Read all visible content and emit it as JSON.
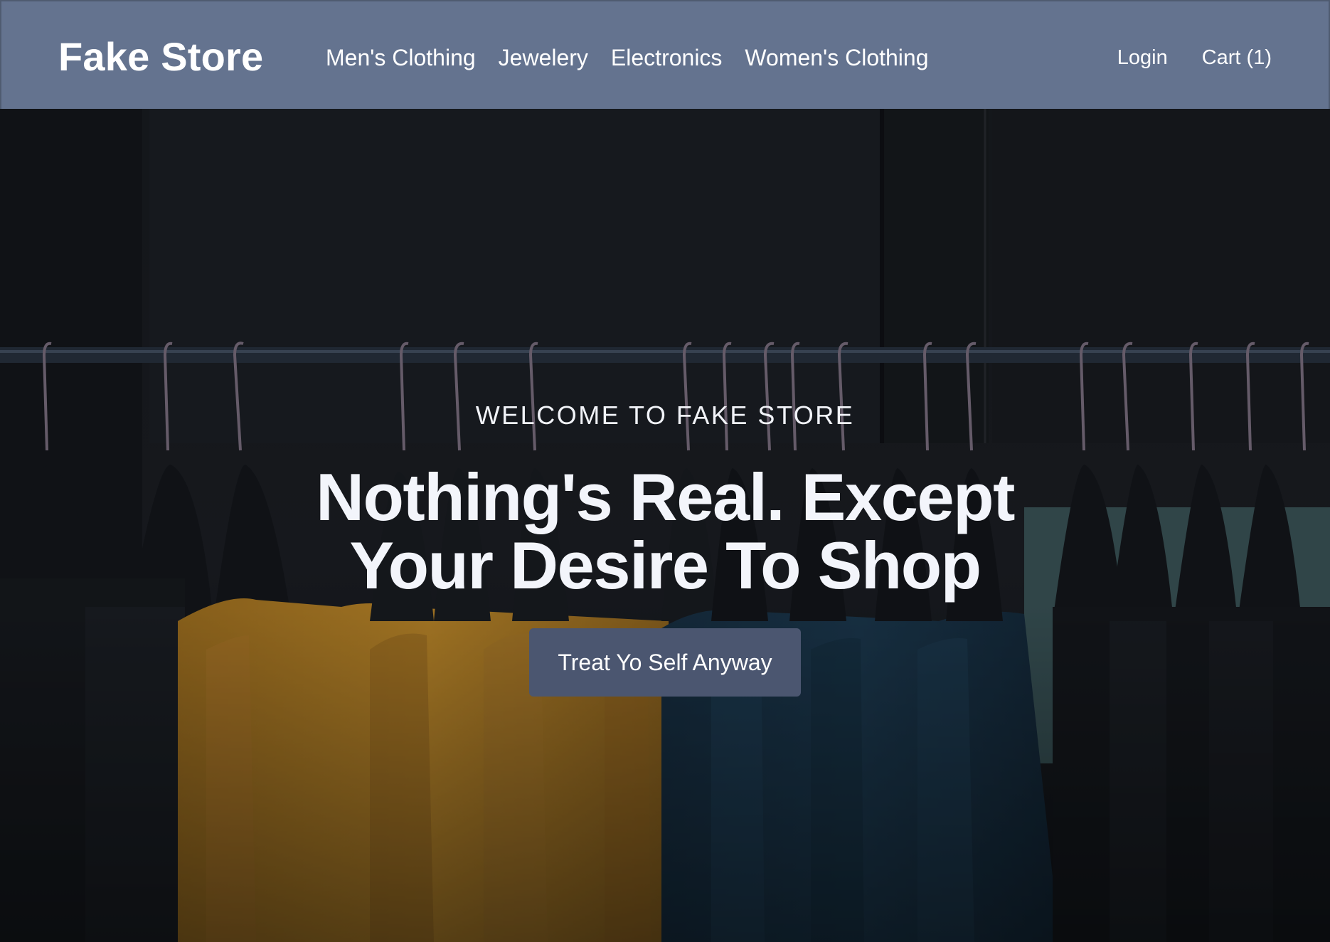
{
  "brand": {
    "name": "Fake Store"
  },
  "nav": {
    "links": [
      {
        "label": "Men's Clothing"
      },
      {
        "label": "Jewelery"
      },
      {
        "label": "Electronics"
      },
      {
        "label": "Women's Clothing"
      }
    ],
    "login_label": "Login",
    "cart_label": "Cart (1)"
  },
  "hero": {
    "kicker": "WELCOME TO FAKE STORE",
    "headline": "Nothing's Real. Except Your Desire To Shop",
    "cta_label": "Treat Yo Self Anyway"
  },
  "colors": {
    "navbar": "#64738f",
    "cta": "#4b5670",
    "text": "#ffffff"
  }
}
